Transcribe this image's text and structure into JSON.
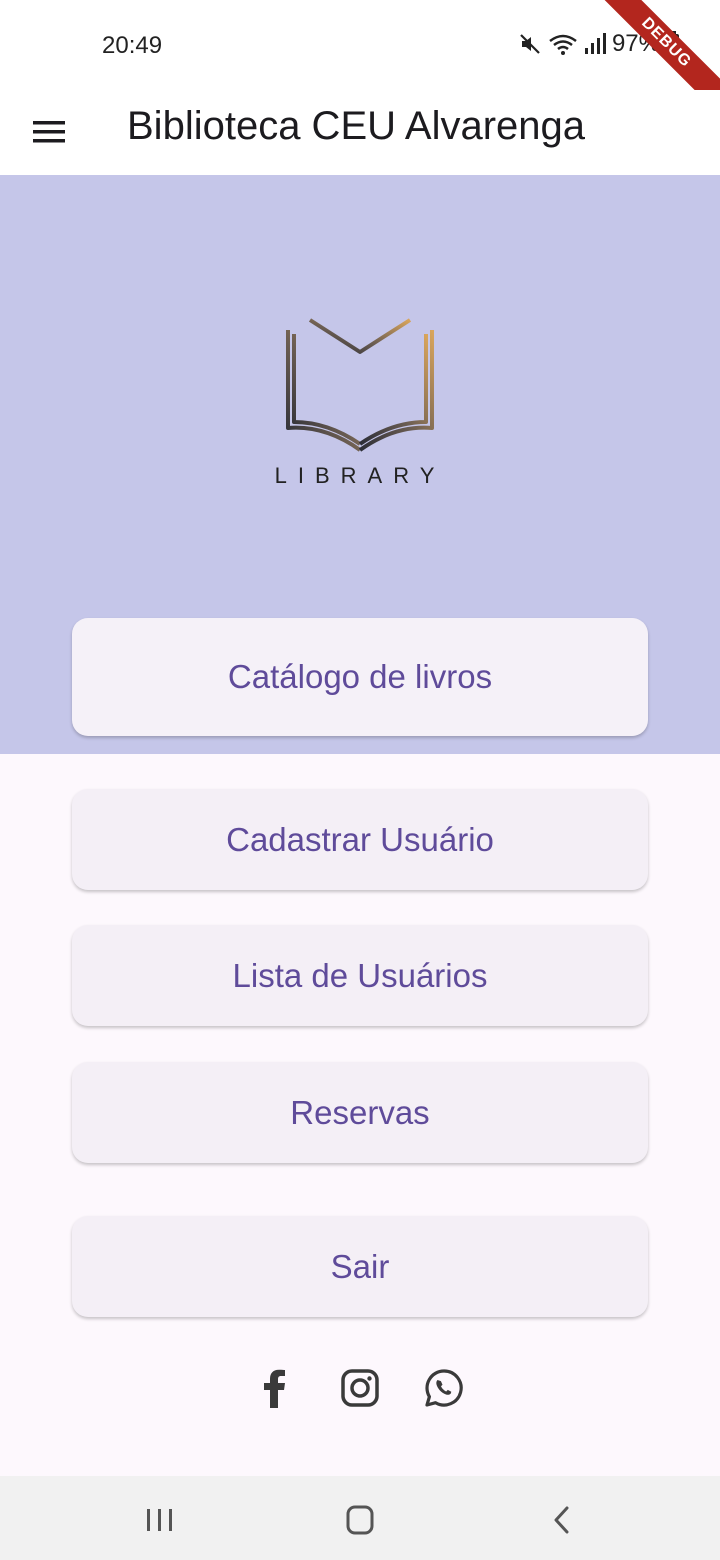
{
  "status_bar": {
    "time": "20:49",
    "battery": "97%",
    "icons": [
      "mute-icon",
      "wifi-icon",
      "signal-icon",
      "battery-icon"
    ]
  },
  "debug_banner": "DEBUG",
  "app_bar": {
    "title": "Biblioteca CEU Alvarenga",
    "menu_icon": "hamburger-menu-icon"
  },
  "hero": {
    "logo_text": "LIBRARY",
    "background": "#c5c6e9"
  },
  "buttons": {
    "catalog": "Catálogo de livros",
    "register_user": "Cadastrar Usuário",
    "user_list": "Lista de Usuários",
    "reservations": "Reservas",
    "logout": "Sair"
  },
  "social": [
    "facebook-icon",
    "instagram-icon",
    "whatsapp-icon"
  ],
  "colors": {
    "accent": "#5f4b9a",
    "button_bg": "#f4eff6",
    "page_bg": "#fdf8fd"
  },
  "nav_bar": [
    "recent-apps-icon",
    "home-icon",
    "back-icon"
  ]
}
